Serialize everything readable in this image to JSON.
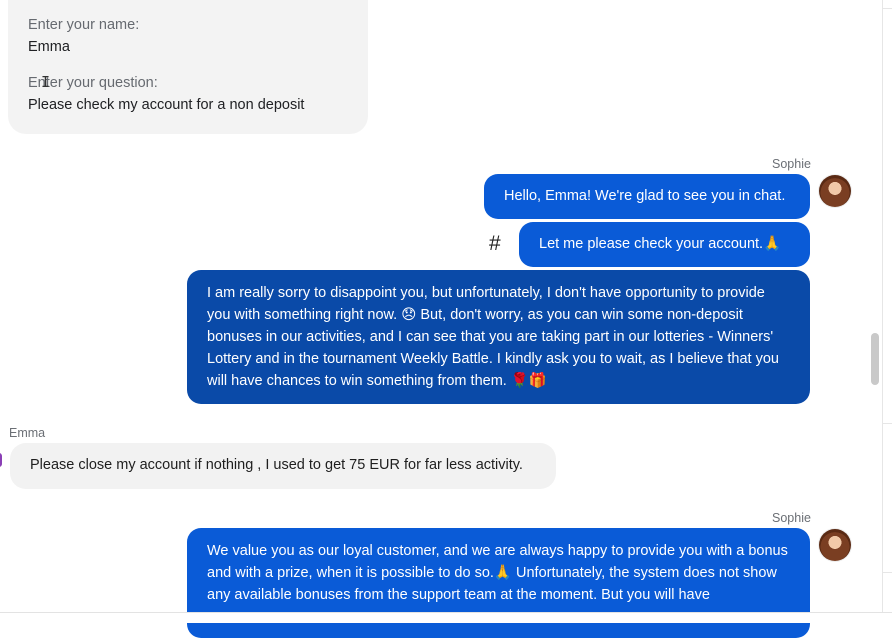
{
  "form": {
    "name_label": "Enter your name:",
    "name_value": "Emma",
    "question_label": "Enter your question:",
    "question_value": "Please check my account for a non deposit"
  },
  "messages": [
    {
      "sender": "Sophie",
      "direction": "outgoing",
      "text": "Hello, Emma! We're glad to see you in chat."
    },
    {
      "sender": "Sophie",
      "direction": "outgoing",
      "text": "Let me please check your account.🙏"
    },
    {
      "sender": "Sophie",
      "direction": "outgoing",
      "text": "I am really sorry to disappoint you, but unfortunately, I don't have opportunity to provide you with something right now. 😞 But, don't worry, as you can win some non-deposit bonuses in our activities, and I can see that you are taking part in our lotteries - Winners' Lottery and in the tournament Weekly Battle. I kindly ask you to wait, as I believe that you will have chances to win something from them. 🌹🎁"
    },
    {
      "sender": "Emma",
      "direction": "incoming",
      "text": "Please close my account if nothing , I used to get 75 EUR for far less activity."
    },
    {
      "sender": "Sophie",
      "direction": "outgoing",
      "text": "We value you as our loyal customer, and we are always happy to provide you with a bonus and with a prize, when it is possible to do so.🙏 Unfortunately, the system does not show any available bonuses from the support team at the moment. But you will have"
    }
  ],
  "icons": {
    "hash": "#",
    "cursor": "I"
  },
  "colors": {
    "outgoing_bubble": "#0a5bd7",
    "outgoing_bubble_dark": "#0a4aa8",
    "incoming_bubble": "#f2f2f2"
  }
}
